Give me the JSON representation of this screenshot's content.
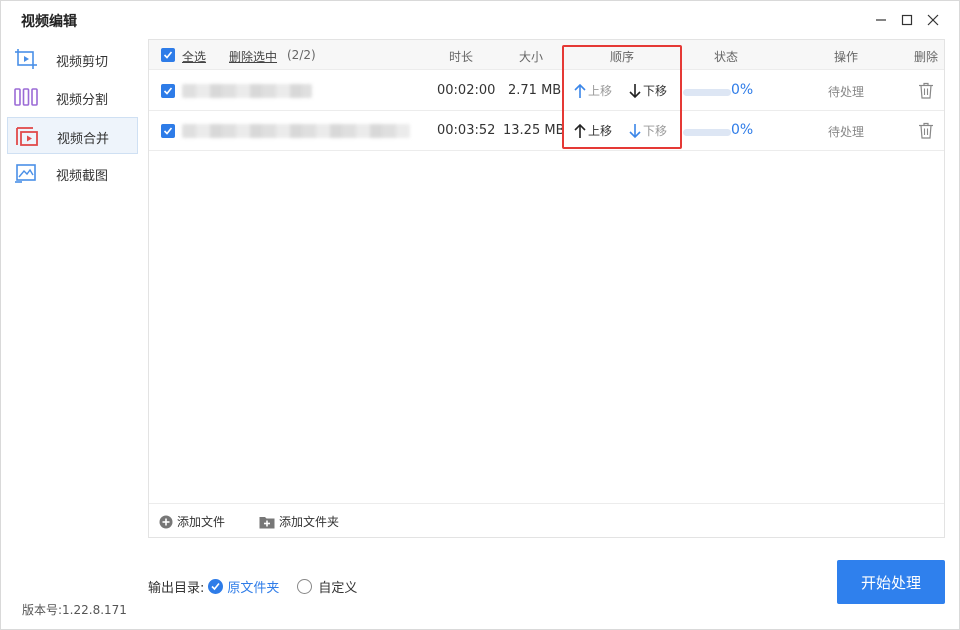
{
  "app": {
    "title": "视频编辑"
  },
  "sidebar": {
    "items": [
      {
        "label": "视频剪切",
        "icon": "crop-icon"
      },
      {
        "label": "视频分割",
        "icon": "split-icon"
      },
      {
        "label": "视频合并",
        "icon": "merge-icon",
        "active": true
      },
      {
        "label": "视频截图",
        "icon": "screenshot-icon"
      }
    ],
    "version": "版本号:1.22.8.171"
  },
  "table": {
    "select_all": "全选",
    "delete_selected": "删除选中",
    "selected_count": "(2/2)",
    "headers": {
      "duration": "时长",
      "size": "大小",
      "order": "顺序",
      "status": "状态",
      "action": "操作",
      "delete": "删除"
    },
    "rows": [
      {
        "checked": true,
        "duration": "00:02:00",
        "size": "2.71 MB",
        "move_up": "上移",
        "move_down": "下移",
        "progress": 0,
        "progress_text": "0%",
        "status": "待处理"
      },
      {
        "checked": true,
        "duration": "00:03:52",
        "size": "13.25 MB",
        "move_up": "上移",
        "move_down": "下移",
        "progress": 0,
        "progress_text": "0%",
        "status": "待处理"
      }
    ]
  },
  "footer": {
    "add_file": "添加文件",
    "add_folder": "添加文件夹"
  },
  "output": {
    "label": "输出目录:",
    "options": [
      "原文件夹",
      "自定义"
    ],
    "selected": "原文件夹"
  },
  "start_button": "开始处理",
  "colors": {
    "accent": "#2e7ce8",
    "highlight": "#e53935"
  }
}
